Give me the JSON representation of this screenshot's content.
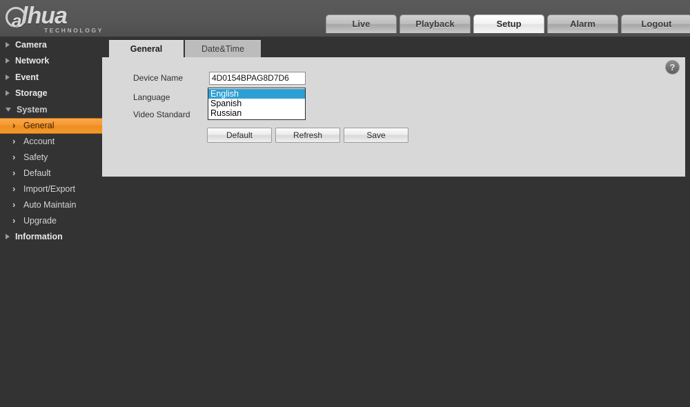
{
  "brand": {
    "name": "alhua",
    "letter": "a",
    "rest": "lhua",
    "tagline": "TECHNOLOGY"
  },
  "topnav": {
    "items": [
      {
        "label": "Live",
        "active": false
      },
      {
        "label": "Playback",
        "active": false
      },
      {
        "label": "Setup",
        "active": true
      },
      {
        "label": "Alarm",
        "active": false
      },
      {
        "label": "Logout",
        "active": false
      }
    ]
  },
  "sidebar": {
    "items": [
      {
        "label": "Camera",
        "level": "top",
        "expanded": false
      },
      {
        "label": "Network",
        "level": "top",
        "expanded": false
      },
      {
        "label": "Event",
        "level": "top",
        "expanded": false
      },
      {
        "label": "Storage",
        "level": "top",
        "expanded": false
      },
      {
        "label": "System",
        "level": "top",
        "expanded": true
      },
      {
        "label": "General",
        "level": "sub",
        "active": true
      },
      {
        "label": "Account",
        "level": "sub",
        "active": false
      },
      {
        "label": "Safety",
        "level": "sub",
        "active": false
      },
      {
        "label": "Default",
        "level": "sub",
        "active": false
      },
      {
        "label": "Import/Export",
        "level": "sub",
        "active": false
      },
      {
        "label": "Auto Maintain",
        "level": "sub",
        "active": false
      },
      {
        "label": "Upgrade",
        "level": "sub",
        "active": false
      },
      {
        "label": "Information",
        "level": "top",
        "expanded": false
      }
    ]
  },
  "content": {
    "tabs": [
      {
        "label": "General",
        "active": true
      },
      {
        "label": "Date&Time",
        "active": false
      }
    ],
    "help_label": "?",
    "form": {
      "device_name_label": "Device Name",
      "device_name_value": "4D0154BPAG8D7D6",
      "language_label": "Language",
      "video_standard_label": "Video Standard"
    },
    "language_dropdown": {
      "open": true,
      "selected": "English",
      "options": [
        "English",
        "Spanish",
        "Russian"
      ]
    },
    "buttons": [
      {
        "label": "Default"
      },
      {
        "label": "Refresh"
      },
      {
        "label": "Save"
      }
    ]
  },
  "colors": {
    "accent_orange": "#f29a2e",
    "select_blue": "#2e9fd4",
    "panel_bg": "#d8d8d8",
    "app_bg": "#333333",
    "header_bg": "#565656"
  }
}
